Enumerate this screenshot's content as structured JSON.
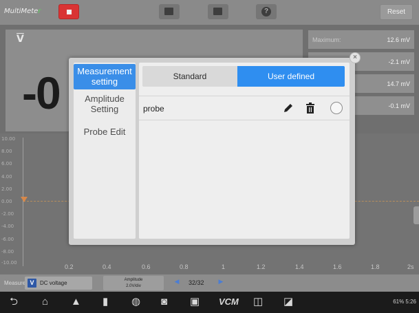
{
  "app": {
    "title_main": "MultiMete",
    "title_accent": "r",
    "reset_label": "Reset"
  },
  "reading": {
    "symbol": "V",
    "value_partial": "-0"
  },
  "stats": [
    {
      "label": "Maximum:",
      "value": "12.6 mV"
    },
    {
      "label": "",
      "value": "-2.1 mV"
    },
    {
      "label": "",
      "value": "14.7 mV"
    },
    {
      "label": "",
      "value": "-0.1 mV"
    }
  ],
  "graph": {
    "y_ticks": [
      "10.00",
      "8.00",
      "6.00",
      "4.00",
      "2.00",
      "0.00",
      "-2.00",
      "-4.00",
      "-6.00",
      "-8.00",
      "-10.00"
    ],
    "x_ticks": [
      "0.2",
      "0.4",
      "0.6",
      "0.8",
      "1",
      "1.2",
      "1.4",
      "1.6",
      "1.8",
      "2s"
    ]
  },
  "bottom": {
    "measure_label": "Measure",
    "dc_label": "DC voltage",
    "dc_icon": "V",
    "amplitude_label": "Amplitude",
    "amplitude_value": "2.0V/div",
    "first_icon": "first-page-icon",
    "page": "32/32",
    "last_icon": "last-page-icon"
  },
  "navbar": {
    "vcm": "VCM",
    "status": "61%  5:26"
  },
  "dialog": {
    "close": "×",
    "side_items": [
      {
        "label": "Measurement setting",
        "active": true
      },
      {
        "label": "Amplitude Setting",
        "active": false
      },
      {
        "label": "Probe Edit",
        "active": false
      }
    ],
    "tabs": {
      "standard": "Standard",
      "user_defined": "User defined",
      "selected": "User defined"
    },
    "probes": [
      {
        "name": "probe",
        "selected": false
      }
    ],
    "colors": {
      "accent": "#3a8ee8",
      "tab_active": "#2f8ef0"
    }
  }
}
